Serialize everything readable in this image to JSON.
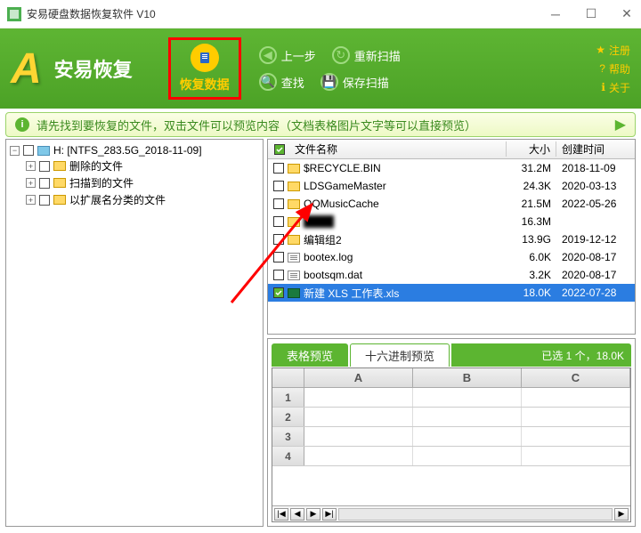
{
  "titlebar": {
    "title": "安易硬盘数据恢复软件 V10"
  },
  "header": {
    "logo_text": "安易恢复",
    "main_btn": "恢复数据",
    "tools": {
      "back": "上一步",
      "rescan": "重新扫描",
      "find": "查找",
      "savescan": "保存扫描"
    },
    "links": {
      "register": "注册",
      "help": "帮助",
      "about": "关于"
    }
  },
  "banner": {
    "text": "请先找到要恢复的文件，双击文件可以预览内容（文档表格图片文字等可以直接预览）"
  },
  "tree": {
    "root": "H: [NTFS_283.5G_2018-11-09]",
    "children": [
      "删除的文件",
      "扫描到的文件",
      "以扩展名分类的文件"
    ]
  },
  "columns": {
    "name": "文件名称",
    "size": "大小",
    "date": "创建时间"
  },
  "files": [
    {
      "name": "$RECYCLE.BIN",
      "size": "31.2M",
      "date": "2018-11-09",
      "type": "folder",
      "checked": false
    },
    {
      "name": "LDSGameMaster",
      "size": "24.3K",
      "date": "2020-03-13",
      "type": "folder",
      "checked": false
    },
    {
      "name": "QQMusicCache",
      "size": "21.5M",
      "date": "2022-05-26",
      "type": "folder",
      "checked": false
    },
    {
      "name": "████",
      "size": "16.3M",
      "date": "",
      "type": "folder",
      "checked": false,
      "blur": true
    },
    {
      "name": "编辑组2",
      "size": "13.9G",
      "date": "2019-12-12",
      "type": "folder",
      "checked": false
    },
    {
      "name": "bootex.log",
      "size": "6.0K",
      "date": "2020-08-17",
      "type": "file",
      "checked": false
    },
    {
      "name": "bootsqm.dat",
      "size": "3.2K",
      "date": "2020-08-17",
      "type": "file",
      "checked": false
    },
    {
      "name": "新建 XLS 工作表.xls",
      "size": "18.0K",
      "date": "2022-07-28",
      "type": "xls",
      "checked": true,
      "selected": true
    }
  ],
  "preview": {
    "tabs": {
      "table": "表格预览",
      "hex": "十六进制预览"
    },
    "status": "已选 1 个，18.0K",
    "cols": [
      "A",
      "B",
      "C"
    ],
    "rows": [
      "1",
      "2",
      "3",
      "4"
    ]
  }
}
